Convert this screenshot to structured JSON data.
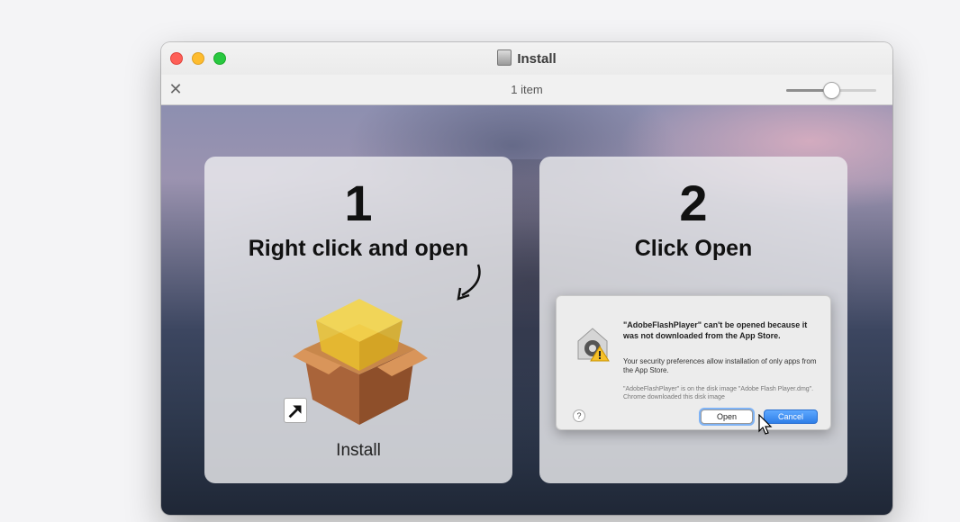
{
  "window": {
    "title": "Install",
    "item_count": "1 item",
    "zoom_level": 0.5,
    "close_glyph": "✕"
  },
  "steps": [
    {
      "number": "1",
      "heading": "Right click and open",
      "file_label": "Install"
    },
    {
      "number": "2",
      "heading": "Click Open"
    }
  ],
  "dialog": {
    "title": "\"AdobeFlashPlayer\" can't be opened because it was not downloaded from the App Store.",
    "body": "Your security preferences allow installation of only apps from the App Store.",
    "detail": "\"AdobeFlashPlayer\" is on the disk image \"Adobe Flash Player.dmg\". Chrome downloaded this disk image",
    "help": "?",
    "open_label": "Open",
    "cancel_label": "Cancel"
  },
  "colors": {
    "close": "#fe5f57",
    "minimize": "#febc2e",
    "maximize": "#28c840",
    "accent": "#2f7fe8"
  },
  "icons": [
    "disk-image-icon",
    "close-icon",
    "curved-arrow-icon",
    "package-icon",
    "alias-arrow-icon",
    "security-lock-icon",
    "warning-icon",
    "pointer-cursor-icon"
  ]
}
